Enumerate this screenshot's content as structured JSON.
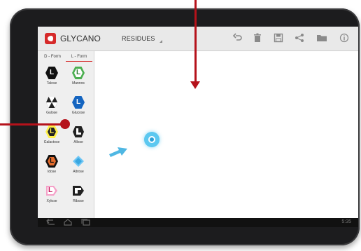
{
  "app": {
    "title": "GLYCANO",
    "menu_label": "RESIDUES"
  },
  "toolbar": {
    "icons": [
      "undo-icon",
      "trash-icon",
      "save-icon",
      "share-icon",
      "folder-icon",
      "info-icon"
    ]
  },
  "panel": {
    "tabs": [
      "D - Form",
      "L - Form"
    ],
    "active_tab": "L - Form",
    "residues": [
      {
        "label": "Talose",
        "letter": "L",
        "color": "#111111",
        "shape": "hex"
      },
      {
        "label": "Mannos",
        "letter": "L",
        "color": "#4caf50",
        "shape": "hex"
      },
      {
        "label": "Gulose",
        "letter": "",
        "color": "#222222",
        "shape": "split"
      },
      {
        "label": "Glucose",
        "letter": "L",
        "color": "#1565c0",
        "shape": "hex"
      },
      {
        "label": "Galactose",
        "letter": "L",
        "color": "#fff04a",
        "shape": "hex"
      },
      {
        "label": "Allose",
        "letter": "L",
        "color": "#222222",
        "shape": "square"
      },
      {
        "label": "Idose",
        "letter": "L",
        "color": "#111111",
        "shape": "hex-orange"
      },
      {
        "label": "Altrose",
        "letter": "",
        "color": "#6ec6f5",
        "shape": "diamond"
      },
      {
        "label": "Xylose",
        "letter": "L",
        "color": "#f5a0c8",
        "shape": "tag"
      },
      {
        "label": "Ribose",
        "letter": "",
        "color": "#222222",
        "shape": "tab"
      }
    ]
  },
  "status": {
    "clock": "5:35"
  },
  "colors": {
    "accent": "#b5121b",
    "touch": "#5cc8f0"
  }
}
